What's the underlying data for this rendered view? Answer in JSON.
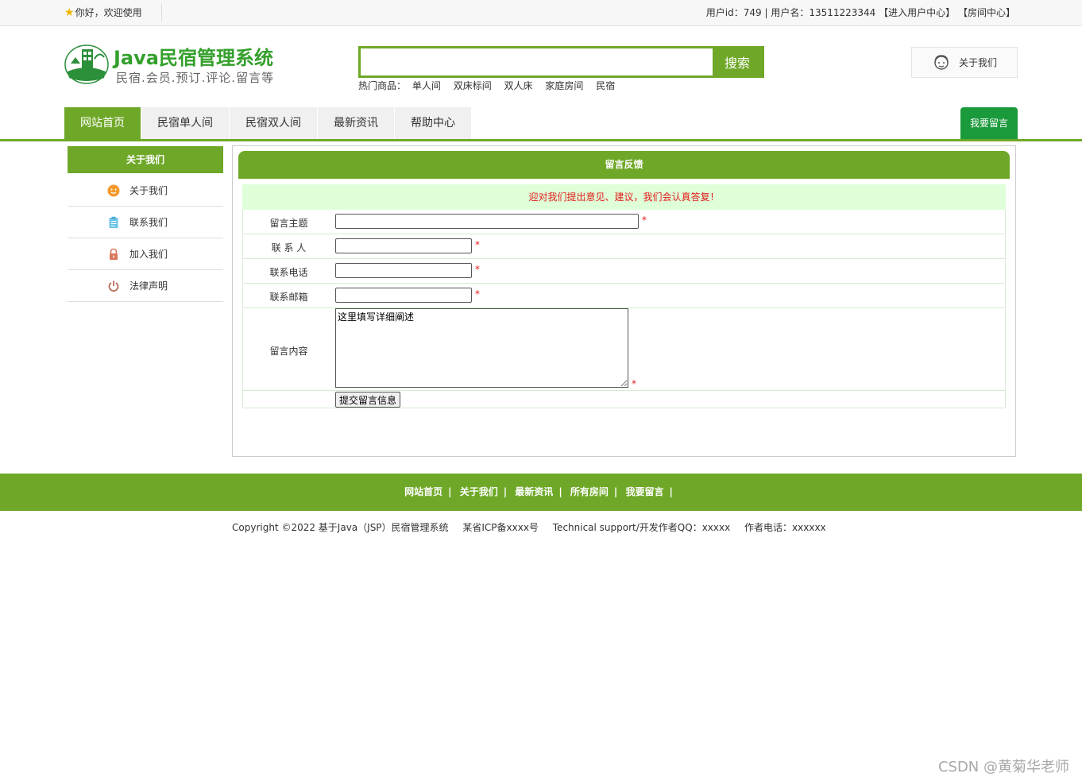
{
  "topbar": {
    "welcome": "你好，欢迎使用",
    "user_info": "用户id：749 | 用户名：13511223344",
    "user_center_link": "【进入用户中心】",
    "room_center_link": "【房间中心】"
  },
  "header": {
    "logo_title": "Java民宿管理系统",
    "logo_subtitle": "民宿.会员.预订.评论.留言等",
    "search": {
      "placeholder": "",
      "button": "搜索"
    },
    "hot_label": "热门商品：",
    "hot_items": [
      "单人间",
      "双床标间",
      "双人床",
      "家庭房间",
      "民宿"
    ],
    "about_button": "关于我们"
  },
  "nav": {
    "tabs": [
      {
        "label": "网站首页",
        "active": true
      },
      {
        "label": "民宿单人间",
        "active": false
      },
      {
        "label": "民宿双人间",
        "active": false
      },
      {
        "label": "最新资讯",
        "active": false
      },
      {
        "label": "帮助中心",
        "active": false
      }
    ],
    "leave_message": "我要留言"
  },
  "sidebar": {
    "title": "关于我们",
    "items": [
      {
        "label": "关于我们",
        "icon": "smile-icon"
      },
      {
        "label": "联系我们",
        "icon": "clipboard-icon"
      },
      {
        "label": "加入我们",
        "icon": "lock-icon"
      },
      {
        "label": "法律声明",
        "icon": "power-icon"
      }
    ]
  },
  "form": {
    "title": "留言反馈",
    "notice": "迎对我们提出意见、建议，我们会认真答复！",
    "fields": {
      "subject": "留言主题",
      "contact": "联 系 人",
      "phone": "联系电话",
      "email": "联系邮箱",
      "content": "留言内容"
    },
    "content_value": "这里填写详细阐述",
    "required_mark": "*",
    "submit": "提交留言信息"
  },
  "footer": {
    "links": [
      "网站首页",
      "关于我们",
      "最新资讯",
      "所有房间",
      "我要留言"
    ],
    "separator": "|",
    "copyright": "Copyright ©2022 基于Java（JSP）民宿管理系统",
    "icp": "某省ICP备xxxx号",
    "support": "Technical support/开发作者QQ：xxxxx",
    "phone": "作者电话：xxxxxx"
  },
  "watermark": "CSDN @黄菊华老师",
  "colors": {
    "brand_green": "#6fa828",
    "leave_green": "#1b9a3c",
    "notice_bg": "#dfffd9",
    "required_red": "#e31b1b"
  }
}
